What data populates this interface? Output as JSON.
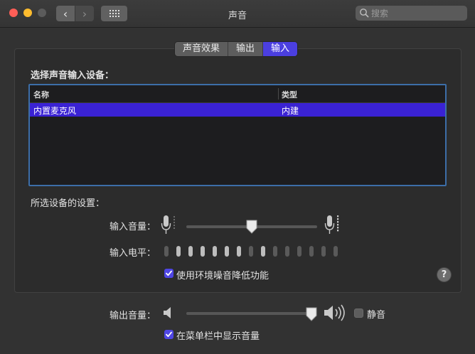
{
  "window": {
    "title": "声音"
  },
  "toolbar": {
    "back_glyph": "‹",
    "forward_glyph": "›",
    "search_placeholder": "搜索"
  },
  "tabs": [
    {
      "label": "声音效果",
      "active": false
    },
    {
      "label": "输出",
      "active": false
    },
    {
      "label": "输入",
      "active": true
    }
  ],
  "input_section": {
    "heading": "选择声音输入设备：",
    "table": {
      "columns": [
        "名称",
        "类型"
      ],
      "rows": [
        {
          "name": "内置麦克风",
          "type": "内建",
          "selected": true
        }
      ]
    }
  },
  "device_settings": {
    "heading": "所选设备的设置：",
    "input_volume_label": "输入音量：",
    "input_volume_fraction": 0.5,
    "input_level_label": "输入电平：",
    "input_level_segments": 15,
    "input_level_lit": [
      1,
      2,
      3,
      4,
      5,
      6,
      8
    ],
    "noise_reduction_label": "使用环境噪音降低功能",
    "noise_reduction_checked": true,
    "help_glyph": "?"
  },
  "output": {
    "volume_label": "输出音量：",
    "volume_fraction": 1.0,
    "mute_label": "静音",
    "mute_checked": false,
    "show_in_menubar_label": "在菜单栏中显示音量",
    "show_in_menubar_checked": true
  },
  "colors": {
    "accent": "#4f46e5",
    "selection": "#3a22d4",
    "table_border": "#3c6ea8"
  }
}
